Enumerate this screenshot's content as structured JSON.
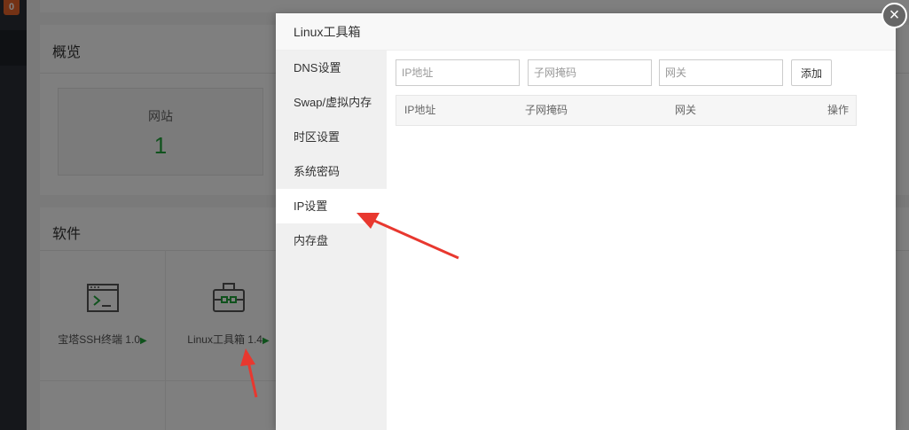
{
  "background": {
    "badge": "0",
    "overview": {
      "title": "概览",
      "stat_label": "网站",
      "stat_value": "1"
    },
    "software": {
      "title": "软件",
      "items": [
        {
          "name": "宝塔SSH终端 1.0",
          "icon": "terminal-icon"
        },
        {
          "name": "Linux工具箱 1.4",
          "icon": "toolbox-icon"
        }
      ],
      "play_glyph": "▶"
    }
  },
  "modal": {
    "title": "Linux工具箱",
    "close_glyph": "×",
    "menu": [
      {
        "label": "DNS设置",
        "active": false
      },
      {
        "label": "Swap/虚拟内存",
        "active": false
      },
      {
        "label": "时区设置",
        "active": false
      },
      {
        "label": "系统密码",
        "active": false
      },
      {
        "label": "IP设置",
        "active": true
      },
      {
        "label": "内存盘",
        "active": false
      }
    ],
    "form": {
      "ip_placeholder": "IP地址",
      "mask_placeholder": "子网掩码",
      "gateway_placeholder": "网关",
      "add_label": "添加"
    },
    "table": {
      "headers": [
        "IP地址",
        "子网掩码",
        "网关",
        "操作"
      ],
      "rows": []
    }
  },
  "colors": {
    "accent_green": "#20a53a",
    "annotation_red": "#e8382f",
    "badge_orange": "#e8642a"
  }
}
